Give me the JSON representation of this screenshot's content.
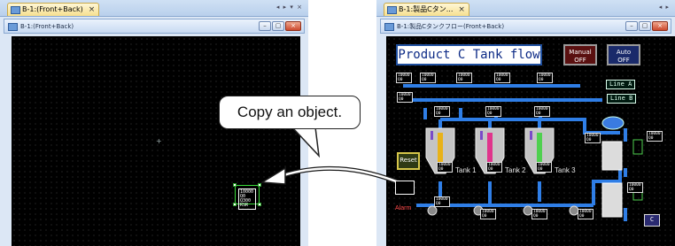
{
  "left_pane": {
    "tab_label": "B-1:(Front+Back)",
    "tab_close": "×",
    "pane_controls": "◂ ▸ ▾ ×",
    "window_title": "B-1:(Front+Back)",
    "window_buttons": {
      "minimize": "–",
      "maximize": "▢",
      "close": "×"
    },
    "copied_object": {
      "dev_line1": "10000 Q0",
      "dev_line2": "Q300 RSR"
    }
  },
  "right_pane": {
    "tab_label": "B-1:製品Cタン...",
    "tab_close": "×",
    "pane_controls": "◂ ▸",
    "window_title": "B-1:製品Cタンクフロー(Front+Back)",
    "window_buttons": {
      "minimize": "–",
      "maximize": "▢",
      "close": "×"
    }
  },
  "hmi": {
    "title": "Product  C  Tank flow",
    "manual_button": {
      "line1": "Manual",
      "line2": "OFF"
    },
    "auto_button": {
      "line1": "Auto",
      "line2": "OFF"
    },
    "line_a": "Line A",
    "line_b": "Line B",
    "reset_label": "Reset",
    "tank_labels": [
      "Tank 1",
      "Tank 2",
      "Tank 3"
    ],
    "alarm_label": "Alarm",
    "device_tag": "10000\nQ0",
    "bottom_right_label": "C"
  },
  "callout": {
    "text": "Copy an object."
  },
  "colors": {
    "tank1_level": "#e8b219",
    "tank2_level": "#e0348c",
    "tank3_level": "#4fd04f",
    "pipe": "#2f7ee6",
    "title_border": "#1f4f9e"
  }
}
